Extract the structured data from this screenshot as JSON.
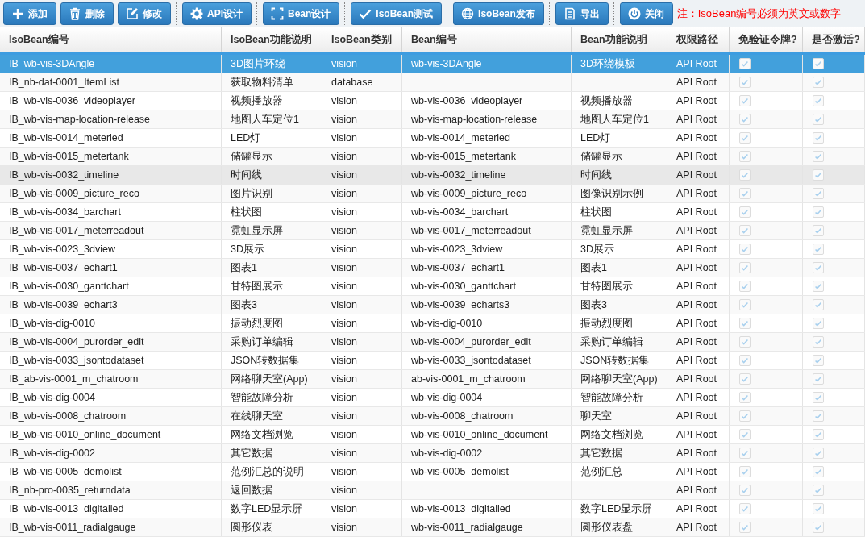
{
  "toolbar": {
    "groups": [
      [
        {
          "label": "添加",
          "kind": "plus"
        },
        {
          "label": "删除",
          "kind": "trash"
        },
        {
          "label": "修改",
          "kind": "edit"
        }
      ],
      [
        {
          "label": "API设计",
          "kind": "gear"
        }
      ],
      [
        {
          "label": "Bean设计",
          "kind": "frame"
        }
      ],
      [
        {
          "label": "IsoBean测试",
          "kind": "check"
        }
      ],
      [
        {
          "label": "IsoBean发布",
          "kind": "globe"
        }
      ],
      [
        {
          "label": "导出",
          "kind": "doc"
        }
      ],
      [
        {
          "label": "关闭",
          "kind": "power"
        }
      ]
    ],
    "note": "注：IsoBean编号必须为英文或数字"
  },
  "table": {
    "columns": [
      "IsoBean编号",
      "IsoBean功能说明",
      "IsoBean类别",
      "Bean编号",
      "Bean功能说明",
      "权限路径",
      "免验证令牌?",
      "是否激活?"
    ],
    "rows": [
      {
        "cells": [
          "IB_wb-vis-3DAngle",
          "3D图片环绕",
          "vision",
          "wb-vis-3DAngle",
          "3D环绕模板",
          "API Root"
        ],
        "no_token": true,
        "active": true,
        "selected": true,
        "hovered": false
      },
      {
        "cells": [
          "IB_nb-dat-0001_ItemList",
          "获取物料清单",
          "database",
          "",
          "",
          "API Root"
        ],
        "no_token": true,
        "active": true,
        "selected": false,
        "hovered": false
      },
      {
        "cells": [
          "IB_wb-vis-0036_videoplayer",
          "视频播放器",
          "vision",
          "wb-vis-0036_videoplayer",
          "视频播放器",
          "API Root"
        ],
        "no_token": true,
        "active": true,
        "selected": false,
        "hovered": false
      },
      {
        "cells": [
          "IB_wb-vis-map-location-release",
          "地图人车定位1",
          "vision",
          "wb-vis-map-location-release",
          "地图人车定位1",
          "API Root"
        ],
        "no_token": true,
        "active": true,
        "selected": false,
        "hovered": false
      },
      {
        "cells": [
          "IB_wb-vis-0014_meterled",
          "LED灯",
          "vision",
          "wb-vis-0014_meterled",
          "LED灯",
          "API Root"
        ],
        "no_token": true,
        "active": true,
        "selected": false,
        "hovered": false
      },
      {
        "cells": [
          "IB_wb-vis-0015_metertank",
          "储罐显示",
          "vision",
          "wb-vis-0015_metertank",
          "储罐显示",
          "API Root"
        ],
        "no_token": true,
        "active": true,
        "selected": false,
        "hovered": false
      },
      {
        "cells": [
          "IB_wb-vis-0032_timeline",
          "时间线",
          "vision",
          "wb-vis-0032_timeline",
          "时间线",
          "API Root"
        ],
        "no_token": true,
        "active": true,
        "selected": false,
        "hovered": true
      },
      {
        "cells": [
          "IB_wb-vis-0009_picture_reco",
          "图片识别",
          "vision",
          "wb-vis-0009_picture_reco",
          "图像识别示例",
          "API Root"
        ],
        "no_token": true,
        "active": true,
        "selected": false,
        "hovered": false
      },
      {
        "cells": [
          "IB_wb-vis-0034_barchart",
          "柱状图",
          "vision",
          "wb-vis-0034_barchart",
          "柱状图",
          "API Root"
        ],
        "no_token": true,
        "active": true,
        "selected": false,
        "hovered": false
      },
      {
        "cells": [
          "IB_wb-vis-0017_meterreadout",
          "霓虹显示屏",
          "vision",
          "wb-vis-0017_meterreadout",
          "霓虹显示屏",
          "API Root"
        ],
        "no_token": true,
        "active": true,
        "selected": false,
        "hovered": false
      },
      {
        "cells": [
          "IB_wb-vis-0023_3dview",
          "3D展示",
          "vision",
          "wb-vis-0023_3dview",
          "3D展示",
          "API Root"
        ],
        "no_token": true,
        "active": true,
        "selected": false,
        "hovered": false
      },
      {
        "cells": [
          "IB_wb-vis-0037_echart1",
          "图表1",
          "vision",
          "wb-vis-0037_echart1",
          "图表1",
          "API Root"
        ],
        "no_token": true,
        "active": true,
        "selected": false,
        "hovered": false
      },
      {
        "cells": [
          "IB_wb-vis-0030_ganttchart",
          "甘特图展示",
          "vision",
          "wb-vis-0030_ganttchart",
          "甘特图展示",
          "API Root"
        ],
        "no_token": true,
        "active": true,
        "selected": false,
        "hovered": false
      },
      {
        "cells": [
          "IB_wb-vis-0039_echart3",
          "图表3",
          "vision",
          "wb-vis-0039_echarts3",
          "图表3",
          "API Root"
        ],
        "no_token": true,
        "active": true,
        "selected": false,
        "hovered": false
      },
      {
        "cells": [
          "IB_wb-vis-dig-0010",
          "振动烈度图",
          "vision",
          "wb-vis-dig-0010",
          "振动烈度图",
          "API Root"
        ],
        "no_token": true,
        "active": true,
        "selected": false,
        "hovered": false
      },
      {
        "cells": [
          "IB_wb-vis-0004_purorder_edit",
          "采购订单编辑",
          "vision",
          "wb-vis-0004_purorder_edit",
          "采购订单编辑",
          "API Root"
        ],
        "no_token": true,
        "active": true,
        "selected": false,
        "hovered": false
      },
      {
        "cells": [
          "IB_wb-vis-0033_jsontodataset",
          "JSON转数据集",
          "vision",
          "wb-vis-0033_jsontodataset",
          "JSON转数据集",
          "API Root"
        ],
        "no_token": true,
        "active": true,
        "selected": false,
        "hovered": false
      },
      {
        "cells": [
          "IB_ab-vis-0001_m_chatroom",
          "网络聊天室(App)",
          "vision",
          "ab-vis-0001_m_chatroom",
          "网络聊天室(App)",
          "API Root"
        ],
        "no_token": true,
        "active": true,
        "selected": false,
        "hovered": false
      },
      {
        "cells": [
          "IB_wb-vis-dig-0004",
          "智能故障分析",
          "vision",
          "wb-vis-dig-0004",
          "智能故障分析",
          "API Root"
        ],
        "no_token": true,
        "active": true,
        "selected": false,
        "hovered": false
      },
      {
        "cells": [
          "IB_wb-vis-0008_chatroom",
          "在线聊天室",
          "vision",
          "wb-vis-0008_chatroom",
          "聊天室",
          "API Root"
        ],
        "no_token": true,
        "active": true,
        "selected": false,
        "hovered": false
      },
      {
        "cells": [
          "IB_wb-vis-0010_online_document",
          "网络文档浏览",
          "vision",
          "wb-vis-0010_online_document",
          "网络文档浏览",
          "API Root"
        ],
        "no_token": true,
        "active": true,
        "selected": false,
        "hovered": false
      },
      {
        "cells": [
          "IB_wb-vis-dig-0002",
          "其它数据",
          "vision",
          "wb-vis-dig-0002",
          "其它数据",
          "API Root"
        ],
        "no_token": true,
        "active": true,
        "selected": false,
        "hovered": false
      },
      {
        "cells": [
          "IB_wb-vis-0005_demolist",
          "范例汇总的说明",
          "vision",
          "wb-vis-0005_demolist",
          "范例汇总",
          "API Root"
        ],
        "no_token": true,
        "active": true,
        "selected": false,
        "hovered": false
      },
      {
        "cells": [
          "IB_nb-pro-0035_returndata",
          "返回数据",
          "vision",
          "",
          "",
          "API Root"
        ],
        "no_token": true,
        "active": true,
        "selected": false,
        "hovered": false
      },
      {
        "cells": [
          "IB_wb-vis-0013_digitalled",
          "数字LED显示屏",
          "vision",
          "wb-vis-0013_digitalled",
          "数字LED显示屏",
          "API Root"
        ],
        "no_token": true,
        "active": true,
        "selected": false,
        "hovered": false
      },
      {
        "cells": [
          "IB_wb-vis-0011_radialgauge",
          "圆形仪表",
          "vision",
          "wb-vis-0011_radialgauge",
          "圆形仪表盘",
          "API Root"
        ],
        "no_token": true,
        "active": true,
        "selected": false,
        "hovered": false
      }
    ]
  }
}
